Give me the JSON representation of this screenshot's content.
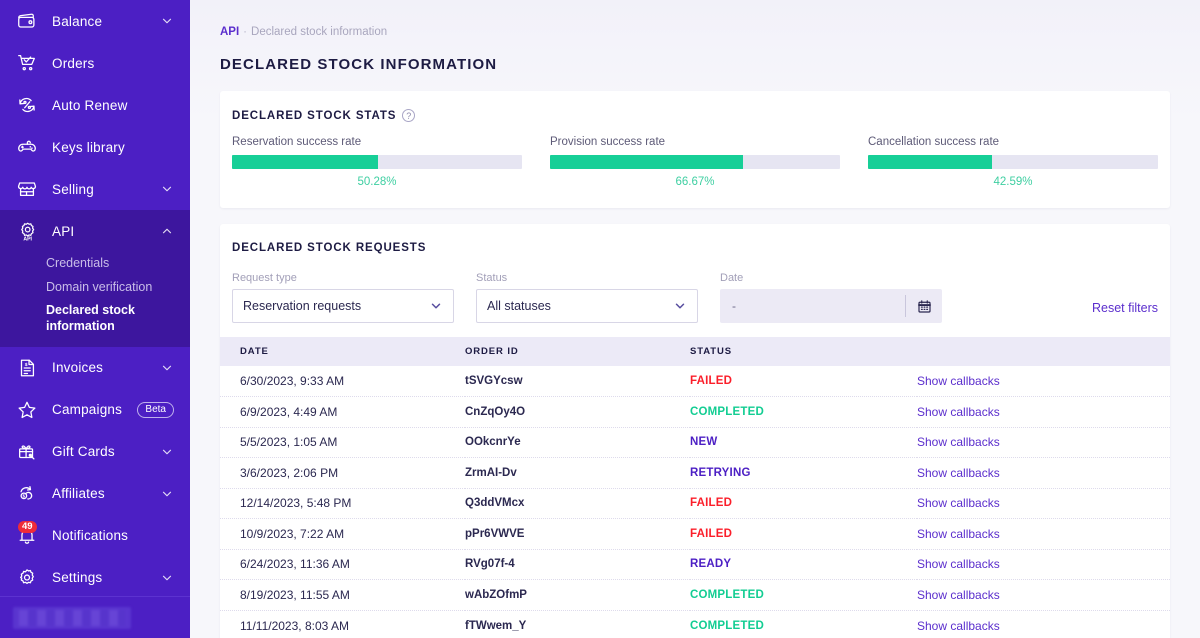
{
  "sidebar": {
    "items": [
      {
        "label": "Balance",
        "icon": "wallet-icon",
        "chevron": "down",
        "key": "balance"
      },
      {
        "label": "Orders",
        "icon": "cart-check-icon",
        "chevron": "none",
        "key": "orders"
      },
      {
        "label": "Auto Renew",
        "icon": "auto-renew-icon",
        "chevron": "none",
        "key": "auto-renew"
      },
      {
        "label": "Keys library",
        "icon": "gamepad-icon",
        "chevron": "none",
        "key": "keys-library"
      },
      {
        "label": "Selling",
        "icon": "storefront-icon",
        "chevron": "down",
        "key": "selling"
      },
      {
        "label": "API",
        "icon": "api-gear-icon",
        "chevron": "up",
        "key": "api",
        "active": true
      },
      {
        "label": "Invoices",
        "icon": "invoice-icon",
        "chevron": "down",
        "key": "invoices"
      },
      {
        "label": "Campaigns",
        "icon": "star-icon",
        "chevron": "none",
        "key": "campaigns",
        "badge": "Beta"
      },
      {
        "label": "Gift Cards",
        "icon": "gift-tag-icon",
        "chevron": "down",
        "key": "gift-cards"
      },
      {
        "label": "Affiliates",
        "icon": "affiliates-icon",
        "chevron": "down",
        "key": "affiliates"
      },
      {
        "label": "Notifications",
        "icon": "bell-icon",
        "chevron": "none",
        "key": "notifications",
        "count": "49"
      },
      {
        "label": "Settings",
        "icon": "gear-icon",
        "chevron": "down",
        "key": "settings"
      }
    ],
    "api_submenu": [
      {
        "label": "Credentials",
        "current": false
      },
      {
        "label": "Domain verification",
        "current": false
      },
      {
        "label": "Declared stock information",
        "current": true
      }
    ],
    "accent": "#4c1fc4",
    "active_bg": "#3d169e"
  },
  "breadcrumb": {
    "root": "API",
    "separator": "·",
    "current": "Declared stock information"
  },
  "page": {
    "title": "DECLARED STOCK INFORMATION"
  },
  "stats_card": {
    "title": "DECLARED STOCK STATS",
    "help_glyph": "?"
  },
  "chart_data": {
    "type": "bar",
    "title": "DECLARED STOCK STATS",
    "orientation": "horizontal",
    "categories": [
      "Reservation success rate",
      "Provision success rate",
      "Cancellation success rate"
    ],
    "values": [
      50.28,
      66.67,
      42.59
    ],
    "value_labels": [
      "50.28%",
      "66.67%",
      "42.59%"
    ],
    "ylim": [
      0,
      100
    ],
    "xlabel": "",
    "ylabel": "",
    "grid": false,
    "legend": false,
    "bar_color": "#17cf97",
    "track_color": "#e6e5f2",
    "label_color": "#3fcfa2"
  },
  "requests_card": {
    "title": "DECLARED STOCK REQUESTS",
    "filters": {
      "request_type": {
        "label": "Request type",
        "value": "Reservation requests"
      },
      "status": {
        "label": "Status",
        "value": "All statuses"
      },
      "date": {
        "label": "Date",
        "value": "-"
      },
      "reset": "Reset filters"
    },
    "table": {
      "columns": [
        "DATE",
        "ORDER ID",
        "STATUS",
        ""
      ],
      "action_label": "Show callbacks",
      "rows": [
        {
          "date": "6/30/2023, 9:33 AM",
          "order_id": "tSVGYcsw",
          "status": "FAILED",
          "action": "Show callbacks"
        },
        {
          "date": "6/9/2023, 4:49 AM",
          "order_id": "CnZqOy4O",
          "status": "COMPLETED",
          "action": "Show callbacks"
        },
        {
          "date": "5/5/2023, 1:05 AM",
          "order_id": "OOkcnrYe",
          "status": "NEW",
          "action": "Show callbacks"
        },
        {
          "date": "3/6/2023, 2:06 PM",
          "order_id": "ZrmAI-Dv",
          "status": "RETRYING",
          "action": "Show callbacks"
        },
        {
          "date": "12/14/2023, 5:48 PM",
          "order_id": "Q3ddVMcx",
          "status": "FAILED",
          "action": "Show callbacks"
        },
        {
          "date": "10/9/2023, 7:22 AM",
          "order_id": "pPr6VWVE",
          "status": "FAILED",
          "action": "Show callbacks"
        },
        {
          "date": "6/24/2023, 11:36 AM",
          "order_id": "RVg07f-4",
          "status": "READY",
          "action": "Show callbacks"
        },
        {
          "date": "8/19/2023, 11:55 AM",
          "order_id": "wAbZOfmP",
          "status": "COMPLETED",
          "action": "Show callbacks"
        },
        {
          "date": "11/11/2023, 8:03 AM",
          "order_id": "fTWwem_Y",
          "status": "COMPLETED",
          "action": "Show callbacks"
        }
      ]
    }
  },
  "colors": {
    "brand_purple": "#4c1fc4",
    "link_purple": "#5b2ecd",
    "status_failed": "#fb1e2a",
    "status_completed": "#12cd92",
    "status_other": "#4c1fc4",
    "bar_green": "#17cf97",
    "badge_red": "#ee2b3a"
  }
}
